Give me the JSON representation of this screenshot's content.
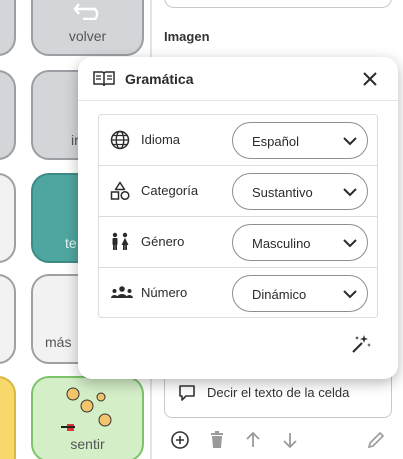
{
  "background": {
    "cells": {
      "volver": "volver",
      "ir_partial": "ir",
      "te_partial": "te",
      "mas_partial": "más",
      "sentir": "sentir"
    },
    "image_label": "Imagen",
    "speak": {
      "text": "Decir el texto de la celda",
      "icon": "speech-bubble-icon"
    },
    "bottom_icons": [
      "add-circle-icon",
      "delete-icon",
      "arrow-up-icon",
      "arrow-down-icon",
      "pencil-icon"
    ]
  },
  "modal": {
    "title": "Gramática",
    "title_icon": "book-icon",
    "close_icon": "close-icon",
    "rows": [
      {
        "label": "Idioma",
        "value": "Español",
        "icon": "globe-icon"
      },
      {
        "label": "Categoría",
        "value": "Sustantivo",
        "icon": "shapes-icon"
      },
      {
        "label": "Género",
        "value": "Masculino",
        "icon": "people-gender-icon"
      },
      {
        "label": "Número",
        "value": "Dinámico",
        "icon": "group-icon"
      }
    ],
    "magic_icon": "magic-wand-icon"
  },
  "colors": {
    "teal_cell": "#4fa6a0",
    "gray_cell": "#d3d6d9",
    "green_cell": "#d4efc8",
    "yellow_cell": "#f7d96b"
  }
}
